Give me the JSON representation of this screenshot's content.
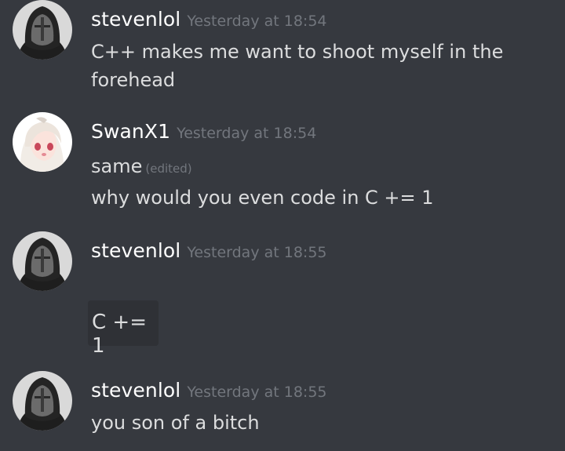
{
  "messages": [
    {
      "username": "stevenlol",
      "timestamp": "Yesterday at 18:54",
      "lines": [
        "C++ makes me want to shoot myself in the",
        "forehead"
      ]
    },
    {
      "username": "SwanX1",
      "timestamp": "Yesterday at 18:54",
      "lines": [
        "same",
        "why would you even code in C += 1"
      ],
      "edited_label": "(edited)"
    },
    {
      "username": "stevenlol",
      "timestamp": "Yesterday at 18:55",
      "code": "C += 1"
    },
    {
      "username": "stevenlol",
      "timestamp": "Yesterday at 18:55",
      "lines": [
        "you son of a bitch"
      ]
    }
  ],
  "colors": {
    "background": "#36393f",
    "username": "#ffffff",
    "timestamp": "#72767d",
    "text": "#dcddde",
    "code_background": "#2f3136"
  },
  "icons": {
    "steven_avatar": "hooded-mask-avatar-icon",
    "swan_avatar": "anime-girl-avatar-icon"
  }
}
